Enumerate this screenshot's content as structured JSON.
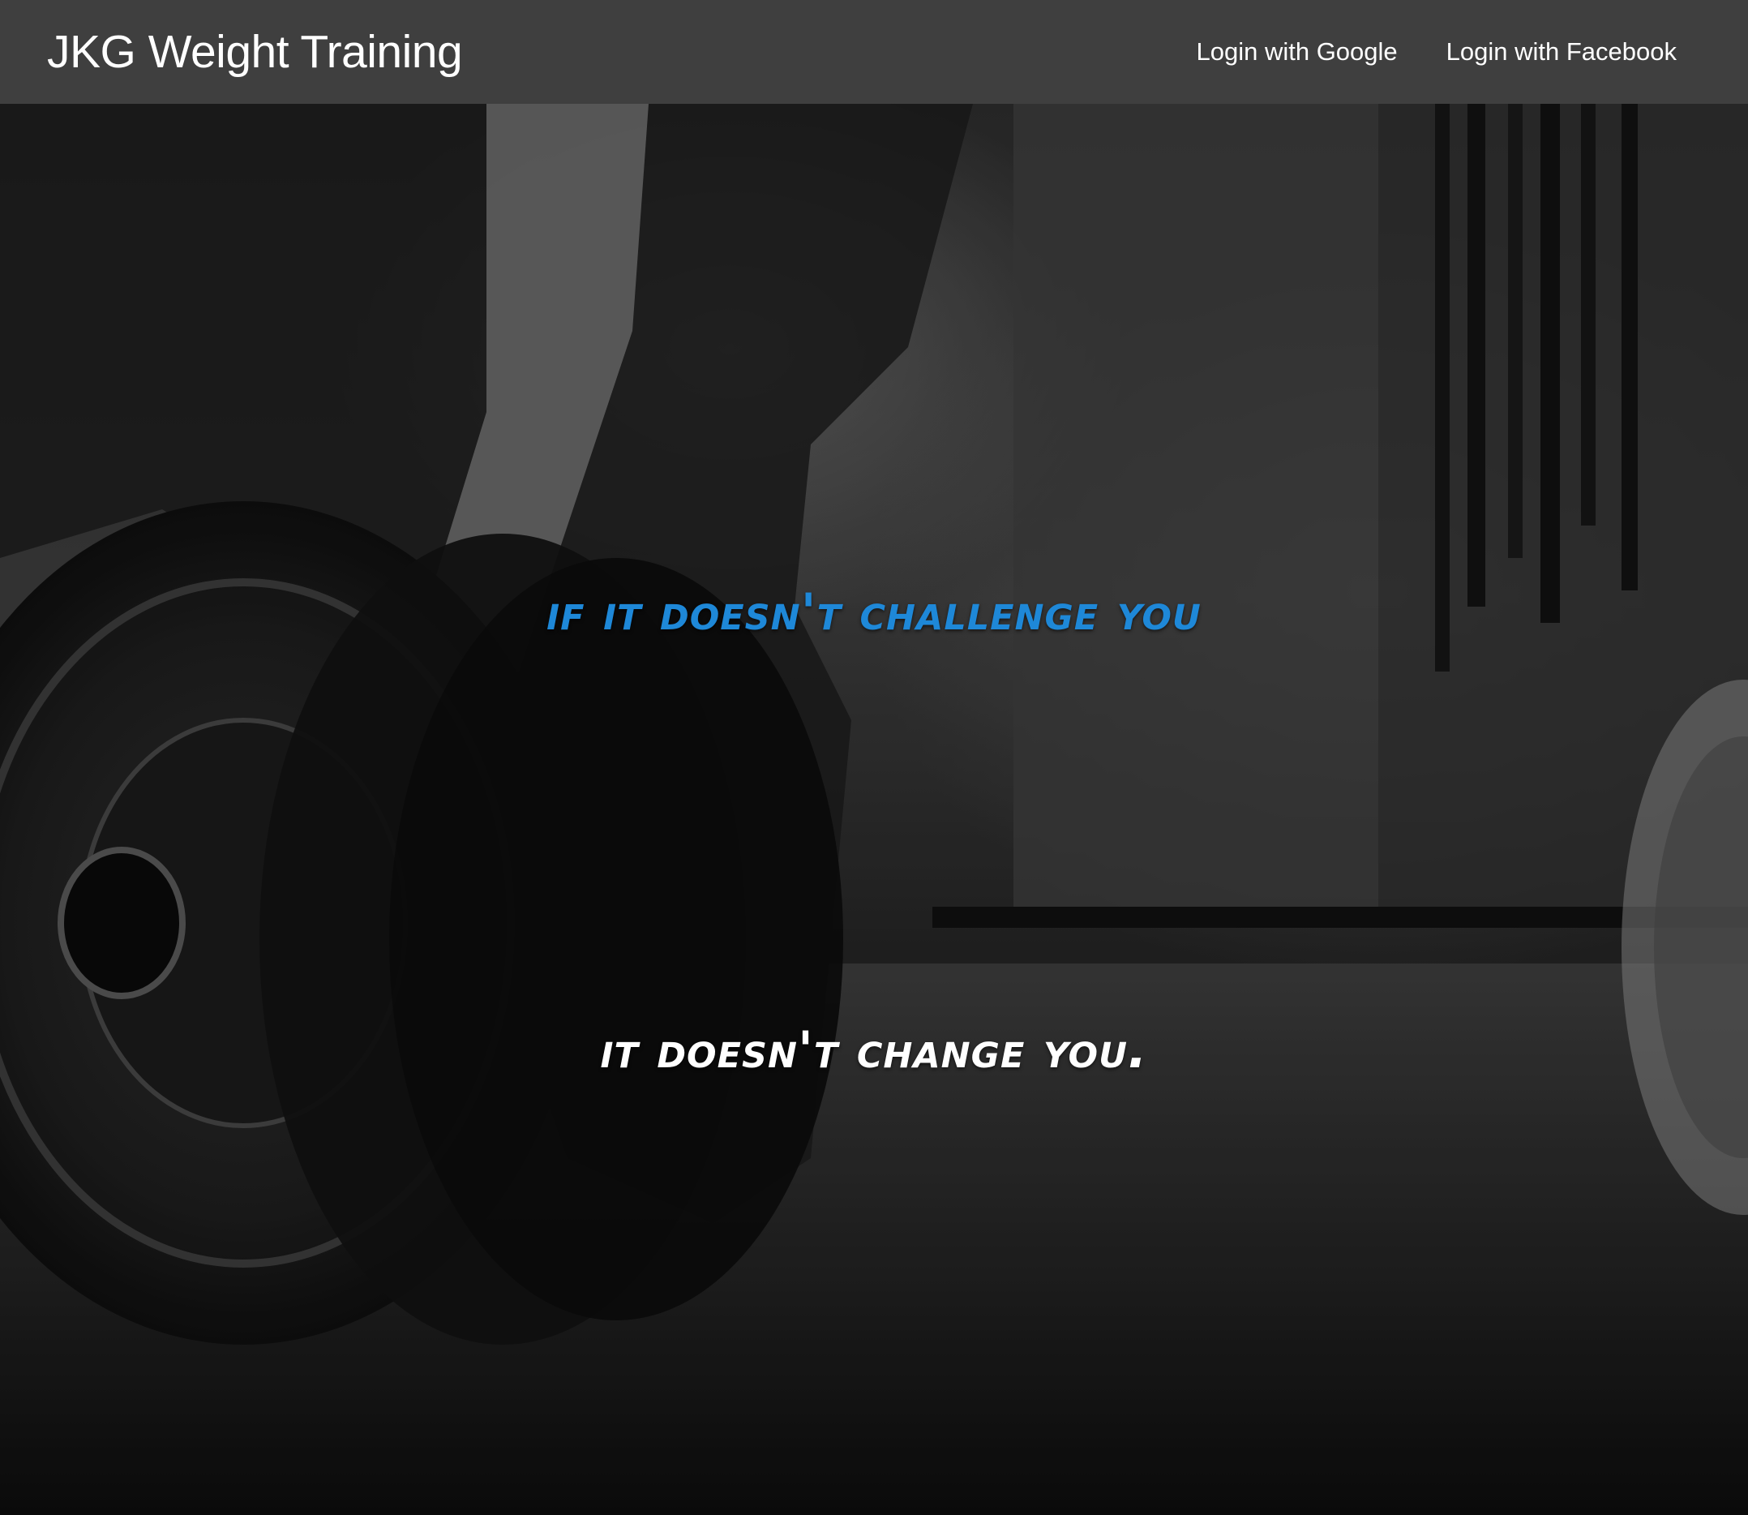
{
  "navbar": {
    "brand": "JKG Weight Training",
    "links": [
      {
        "label": "Login with Google"
      },
      {
        "label": "Login with Facebook"
      }
    ]
  },
  "hero": {
    "quote_line_1": "If it doesn't challenge you",
    "quote_line_2": "it doesn't change you.",
    "colors": {
      "line_1": "#1e88d8",
      "line_2": "#ffffff"
    }
  }
}
